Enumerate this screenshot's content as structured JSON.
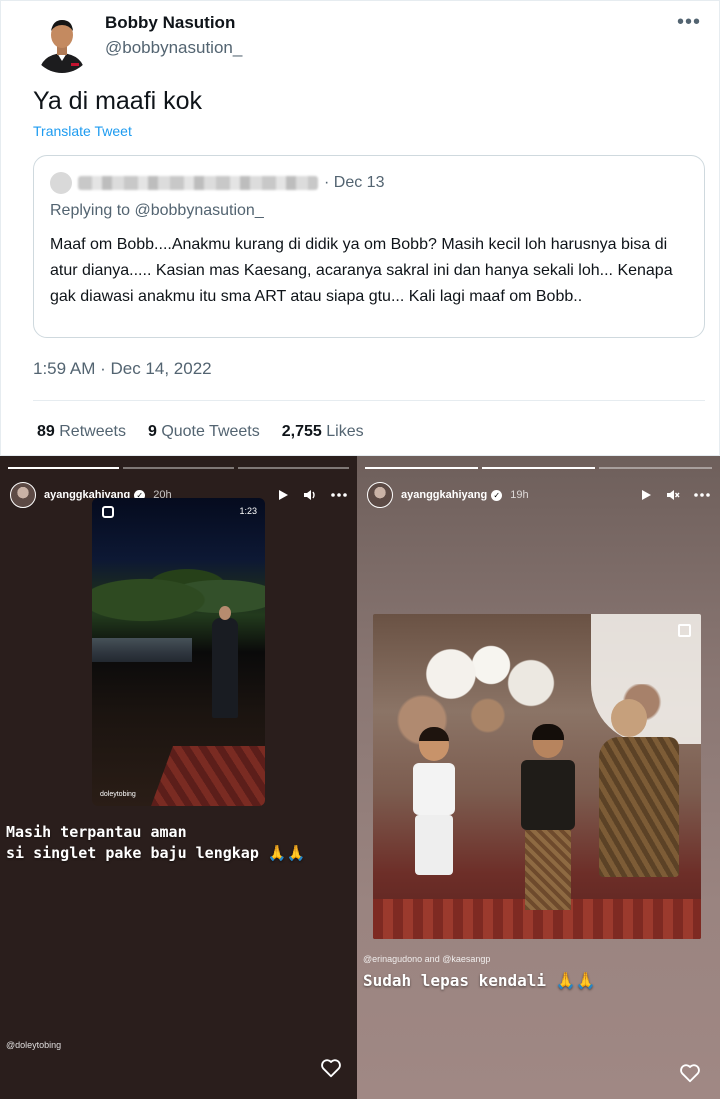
{
  "tweet": {
    "author_name": "Bobby Nasution",
    "author_handle": "@bobbynasution_",
    "more_label": "•••",
    "text": "Ya di maafi kok",
    "translate_label": "Translate Tweet",
    "quote": {
      "date": "· Dec 13",
      "replying_to": "Replying to @bobbynasution_",
      "body": "Maaf om Bobb....Anakmu kurang di didik ya om Bobb? Masih kecil loh harusnya bisa di atur dianya..... Kasian mas Kaesang, acaranya sakral ini dan hanya sekali loh... Kenapa gak diawasi anakmu itu sma ART atau siapa gtu... Kali lagi maaf om Bobb.."
    },
    "timestamp": "1:59 AM · Dec 14, 2022",
    "stats": {
      "retweets_count": "89",
      "retweets_label": "Retweets",
      "quotes_count": "9",
      "quotes_label": "Quote Tweets",
      "likes_count": "2,755",
      "likes_label": "Likes"
    }
  },
  "stories": [
    {
      "username": "ayanggkahiyang",
      "time": "20h",
      "video_duration": "1:23",
      "video_credit": "doleytobing",
      "caption_line1": "Masih terpantau aman",
      "caption_line2": "si singlet pake baju lengkap 🙏🙏",
      "mention": "@doleytobing"
    },
    {
      "username": "ayanggkahiyang",
      "time": "19h",
      "mention": "@erinagudono and @kaesangp",
      "caption": "Sudah lepas kendali 🙏🙏"
    }
  ],
  "colors": {
    "accent": "#1d9bf0",
    "text_primary": "#0f1419",
    "text_secondary": "#536471"
  },
  "icons": [
    "more-icon",
    "verified-icon",
    "play-icon",
    "volume-icon",
    "mute-icon",
    "heart-icon",
    "reels-icon",
    "multi-photo-icon"
  ]
}
